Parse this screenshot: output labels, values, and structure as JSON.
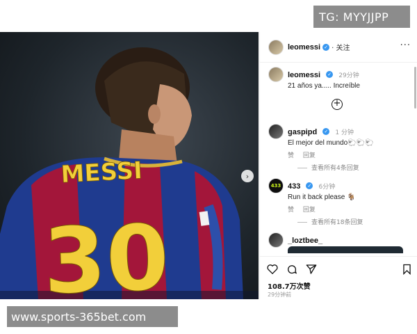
{
  "watermark_top": "TG: MYYJJPP",
  "watermark_bottom": "www.sports-365bet.com",
  "photo": {
    "jersey_name": "MESSI",
    "jersey_number": "30"
  },
  "header": {
    "username": "leomessi",
    "verified_mark": "✓",
    "follow_label": "· 关注",
    "more_label": "···"
  },
  "caption": {
    "username": "leomessi",
    "time": "29分钟",
    "text": "21 años ya..... Increíble"
  },
  "plus_label": "+",
  "comments": [
    {
      "username": "gaspipd",
      "time": "1 分钟",
      "text": "El mejor del mundo🐑🐑🐑",
      "like_label": "赞",
      "reply_label": "回复",
      "view_replies": "查看所有4条回复"
    },
    {
      "username": "433",
      "avatar_text": "433",
      "time": "6分钟",
      "text": "Run it back please 🐐",
      "like_label": "赞",
      "reply_label": "回复",
      "view_replies": "查看所有18条回复"
    },
    {
      "username": "_loztbee_"
    }
  ],
  "action_bar": {
    "likes": "108.7万次赞",
    "post_time": "29分钟前"
  },
  "icons": [
    "heart-icon",
    "comment-icon",
    "share-icon",
    "bookmark-icon",
    "chevron-right-icon",
    "plus-circle-icon",
    "more-icon"
  ],
  "colors": {
    "verified_blue": "#3897f0",
    "barca_blue": "#1f3b8f",
    "barca_red": "#a3163a",
    "jersey_gold": "#f2cf3a"
  }
}
